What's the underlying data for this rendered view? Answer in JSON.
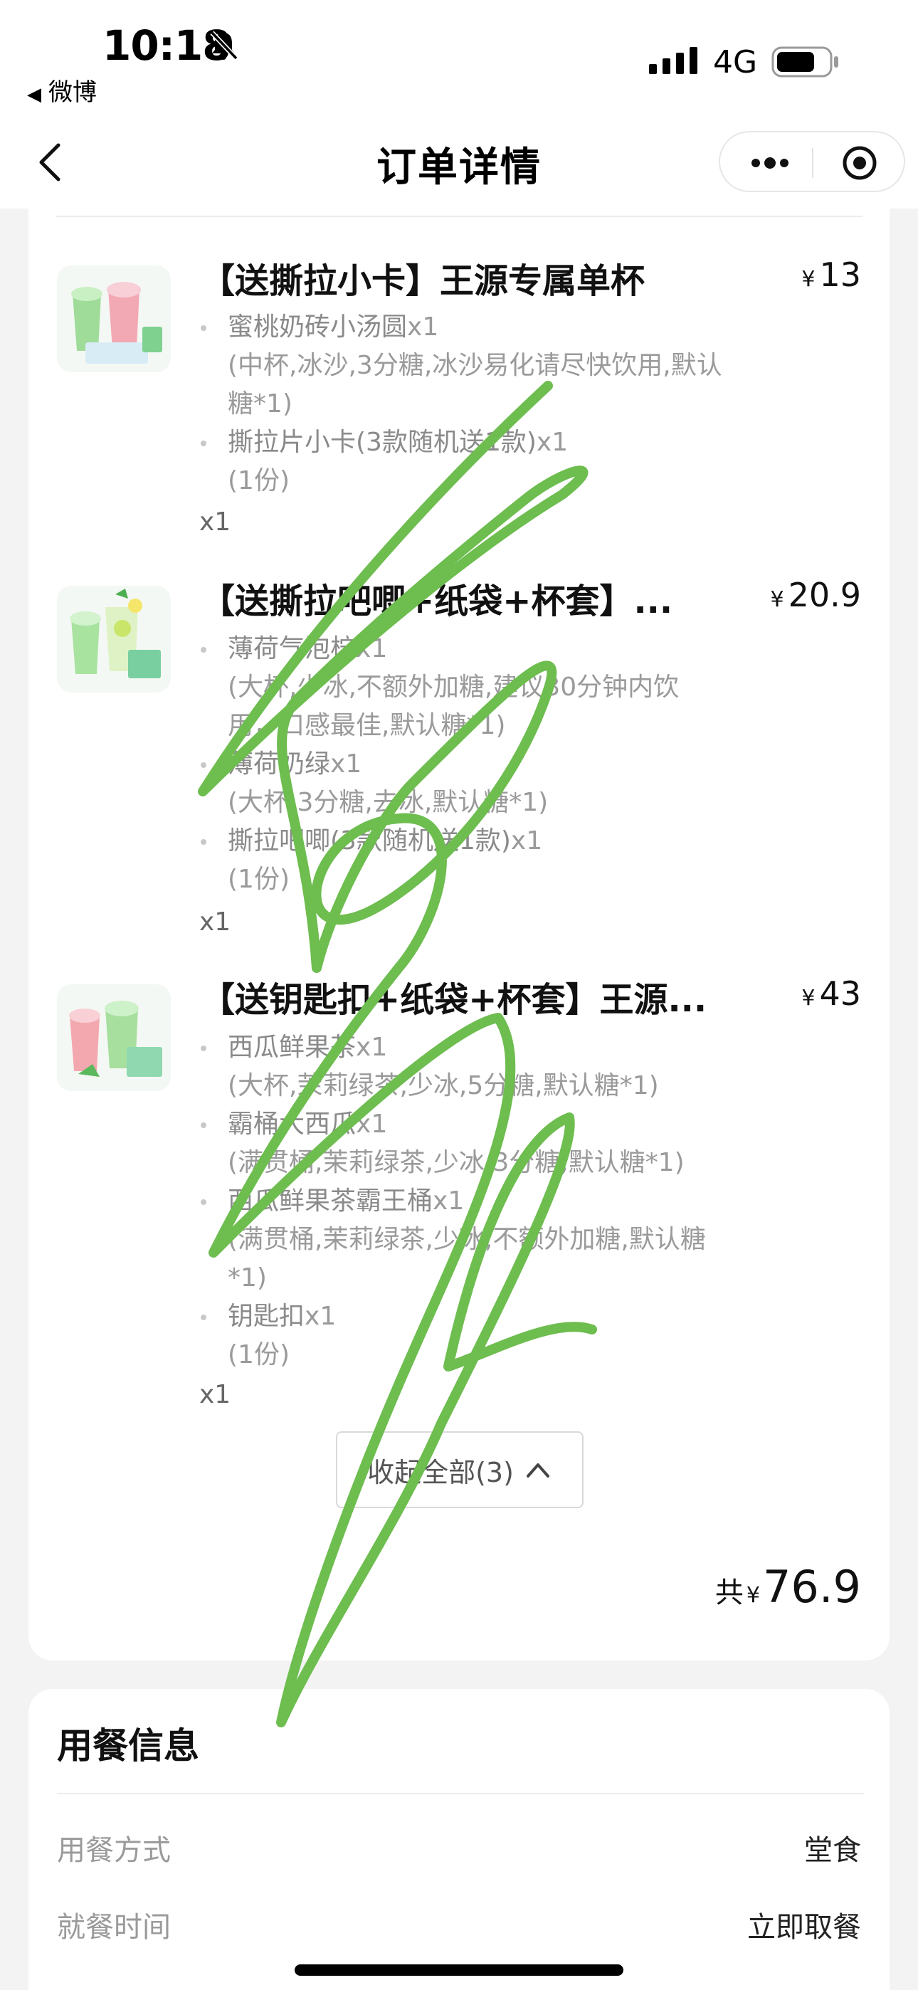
{
  "status_bar": {
    "time": "10:18",
    "back_app": "微博",
    "network": "4G"
  },
  "nav": {
    "title": "订单详情"
  },
  "items": [
    {
      "title": "【送撕拉小卡】王源专属单杯",
      "price": "13",
      "subs": [
        {
          "name": "蜜桃奶砖小汤圆",
          "count": "x1",
          "detail_lines": [
            "(中杯,冰沙,3分糖,冰沙易化请尽快饮用,默认",
            "糖*1)"
          ]
        },
        {
          "name": "撕拉片小卡(3款随机送1款)",
          "count": "x1",
          "detail_lines": [
            "(1份)"
          ]
        }
      ],
      "qty": "x1"
    },
    {
      "title": "【送撕拉吧唧+纸袋+杯套】...",
      "price": "20.9",
      "subs": [
        {
          "name": "薄荷气泡柠",
          "count": "x1",
          "detail_lines": [
            "(大杯,少冰,不额外加糖,建议30分钟内饮",
            "用，口感最佳,默认糖*1)"
          ]
        },
        {
          "name": "薄荷奶绿",
          "count": "x1",
          "detail_lines": [
            "(大杯,3分糖,去冰,默认糖*1)"
          ]
        },
        {
          "name": "撕拉吧唧(3款随机送1款)",
          "count": "x1",
          "detail_lines": [
            "(1份)"
          ]
        }
      ],
      "qty": "x1"
    },
    {
      "title": "【送钥匙扣+纸袋+杯套】王源...",
      "price": "43",
      "subs": [
        {
          "name": "西瓜鲜果茶",
          "count": "x1",
          "detail_lines": [
            "(大杯,茉莉绿茶,少冰,5分糖,默认糖*1)"
          ]
        },
        {
          "name": "霸桶大西瓜",
          "count": "x1",
          "detail_lines": [
            "(满贯桶,茉莉绿茶,少冰,3分糖,默认糖*1)"
          ]
        },
        {
          "name": "西瓜鲜果茶霸王桶",
          "count": "x1",
          "detail_lines": [
            "(满贯桶,茉莉绿茶,少冰,不额外加糖,默认糖",
            "*1)"
          ]
        },
        {
          "name": "钥匙扣",
          "count": "x1",
          "detail_lines": [
            "(1份)"
          ]
        }
      ],
      "qty": "x1"
    }
  ],
  "currency": "¥",
  "collapse_label": "收起全部(3)",
  "total": {
    "prefix": "共",
    "amount": "76.9"
  },
  "dining": {
    "title": "用餐信息",
    "rows": [
      {
        "label": "用餐方式",
        "value": "堂食"
      },
      {
        "label": "就餐时间",
        "value": "立即取餐"
      }
    ]
  },
  "colors": {
    "scribble": "#6dbd4f",
    "muted_text": "#9a9a9a",
    "background": "#f3f3f3"
  },
  "icons": [
    "bell-slash-icon",
    "signal-icon",
    "battery-icon",
    "back-chevron-icon",
    "more-dots-icon",
    "target-icon",
    "chevron-up-icon"
  ]
}
